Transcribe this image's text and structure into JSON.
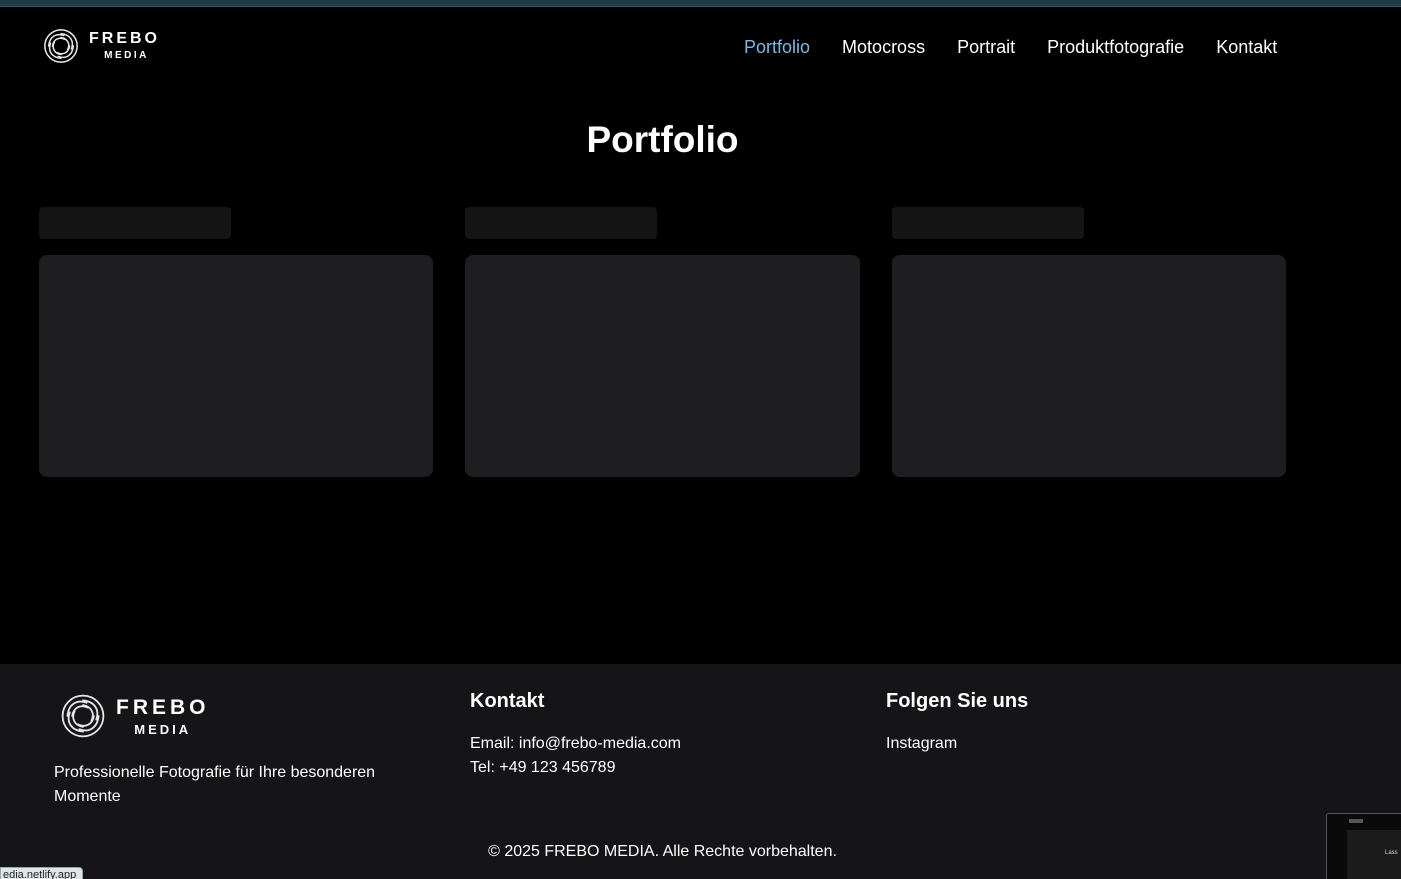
{
  "brand": {
    "name_line_1": "FREBO",
    "name_line_2": "MEDIA"
  },
  "nav": {
    "items": [
      {
        "label": "Portfolio",
        "active": true
      },
      {
        "label": "Motocross",
        "active": false
      },
      {
        "label": "Portrait",
        "active": false
      },
      {
        "label": "Produktfotografie",
        "active": false
      },
      {
        "label": "Kontakt",
        "active": false
      }
    ]
  },
  "main": {
    "title": "Portfolio"
  },
  "footer": {
    "tagline": "Professionelle Fotografie für Ihre besonderen Momente",
    "contact_heading": "Kontakt",
    "email_line": "Email: info@frebo-media.com",
    "phone_line": "Tel: +49 123 456789",
    "social_heading": "Folgen Sie uns",
    "instagram_label": "Instagram",
    "copyright": "© 2025 FREBO MEDIA. Alle Rechte vorbehalten."
  },
  "browser": {
    "status_url": "edia.netlify.app",
    "preview_text": "Lass"
  },
  "colors": {
    "background": "#000000",
    "accent": "#7fb8e3",
    "footer_background": "#151518",
    "skeleton": "#1e1e21"
  }
}
